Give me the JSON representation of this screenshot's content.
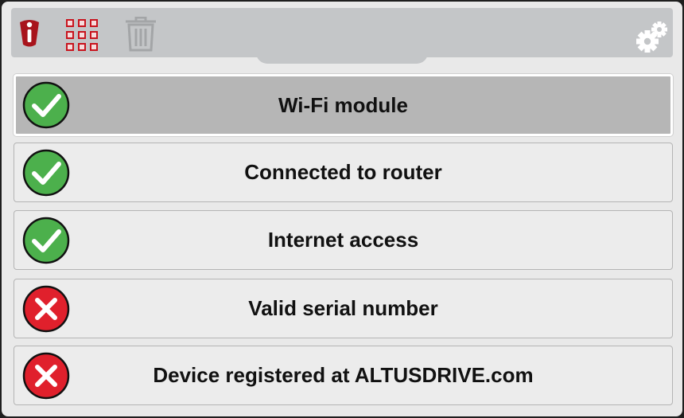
{
  "toolbar": {
    "icons": [
      "info-icon",
      "grid-icon",
      "trash-icon",
      "gear-icon"
    ]
  },
  "status_list": [
    {
      "label": "Wi-Fi module",
      "status": "ok",
      "selected": true
    },
    {
      "label": "Connected to router",
      "status": "ok",
      "selected": false
    },
    {
      "label": "Internet access",
      "status": "ok",
      "selected": false
    },
    {
      "label": "Valid serial number",
      "status": "error",
      "selected": false
    },
    {
      "label": "Device registered at ALTUSDRIVE.com",
      "status": "error",
      "selected": false
    }
  ],
  "colors": {
    "ok": "#4cb04c",
    "error": "#e0202c",
    "brand_red": "#a8141c",
    "toolbar_bg": "#c4c6c8",
    "selected_row_bg": "#b6b6b6"
  }
}
